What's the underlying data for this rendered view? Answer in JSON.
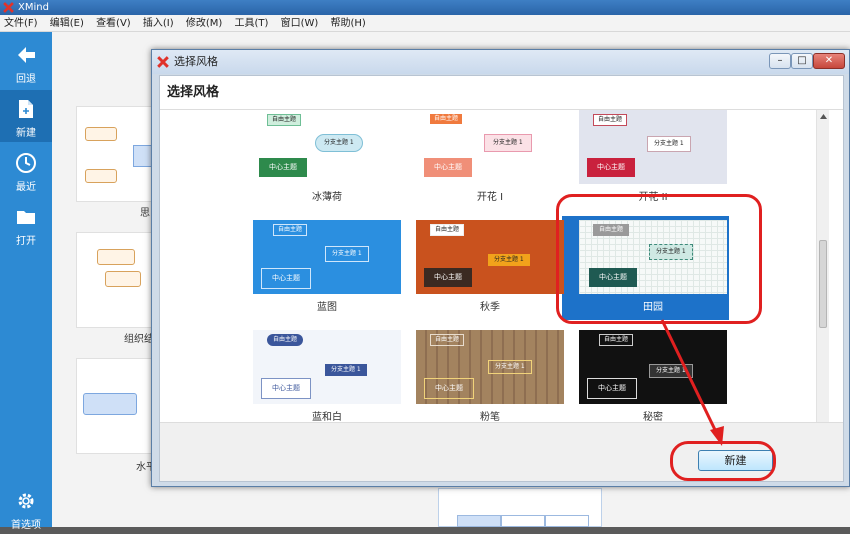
{
  "app": {
    "title": "XMind"
  },
  "menu": [
    "文件(F)",
    "编辑(E)",
    "查看(V)",
    "插入(I)",
    "修改(M)",
    "工具(T)",
    "窗口(W)",
    "帮助(H)"
  ],
  "sidebar": {
    "items": [
      {
        "label": "回退",
        "icon": "arrow-left-icon"
      },
      {
        "label": "新建",
        "icon": "new-file-icon"
      },
      {
        "label": "最近",
        "icon": "clock-icon"
      },
      {
        "label": "打开",
        "icon": "folder-icon"
      }
    ],
    "settings_label": "首选项"
  },
  "background": {
    "labels": [
      "思",
      "组织结",
      "水平"
    ]
  },
  "dialog": {
    "title": "选择风格",
    "header": "选择风格",
    "new_button": "新建",
    "themes": [
      {
        "name": "冰薄荷",
        "central": "中心主题",
        "sub": "分支主题 1",
        "float": "自由主题"
      },
      {
        "name": "开花 I",
        "central": "中心主题",
        "sub": "分支主题 1",
        "float": "自由主题"
      },
      {
        "name": "开花 II",
        "central": "中心主题",
        "sub": "分支主题 1",
        "float": "自由主题"
      },
      {
        "name": "蓝图",
        "central": "中心主题",
        "sub": "分支主题 1",
        "float": "自由主题"
      },
      {
        "name": "秋季",
        "central": "中心主题",
        "sub": "分支主题 1",
        "float": "自由主题"
      },
      {
        "name": "田园",
        "central": "中心主题",
        "sub": "分支主题 1",
        "float": "自由主题"
      },
      {
        "name": "蓝和白",
        "central": "中心主题",
        "sub": "分支主题 1",
        "float": "自由主题"
      },
      {
        "name": "粉笔",
        "central": "中心主题",
        "sub": "分支主题 1",
        "float": "自由主题"
      },
      {
        "name": "秘密",
        "central": "中心主题",
        "sub": "分支主题 1",
        "float": "自由主题"
      }
    ]
  },
  "colors": {
    "sidebar": "#2d8ad3",
    "selection": "#1d72c9",
    "annotation": "#e02020"
  }
}
